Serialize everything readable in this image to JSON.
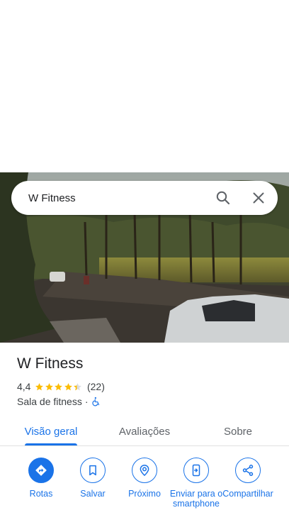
{
  "search": {
    "value": "W Fitness"
  },
  "place": {
    "title": "W Fitness",
    "rating": "4,4",
    "stars_filled": 4.4,
    "stars_total": 5,
    "review_count": "(22)",
    "category": "Sala de fitness",
    "separator": "·"
  },
  "tabs": [
    {
      "label": "Visão geral",
      "active": true
    },
    {
      "label": "Avaliações",
      "active": false
    },
    {
      "label": "Sobre",
      "active": false
    }
  ],
  "actions": [
    {
      "label": "Rotas",
      "icon": "directions-icon"
    },
    {
      "label": "Salvar",
      "icon": "bookmark-icon"
    },
    {
      "label": "Próximo",
      "icon": "nearby-icon"
    },
    {
      "label": "Enviar para o smartphone",
      "icon": "send-to-phone-icon"
    },
    {
      "label": "Compartilhar",
      "icon": "share-icon"
    }
  ],
  "colors": {
    "accent": "#1a73e8",
    "star": "#fbbc04",
    "text_primary": "#202124",
    "text_secondary": "#3c4043"
  }
}
